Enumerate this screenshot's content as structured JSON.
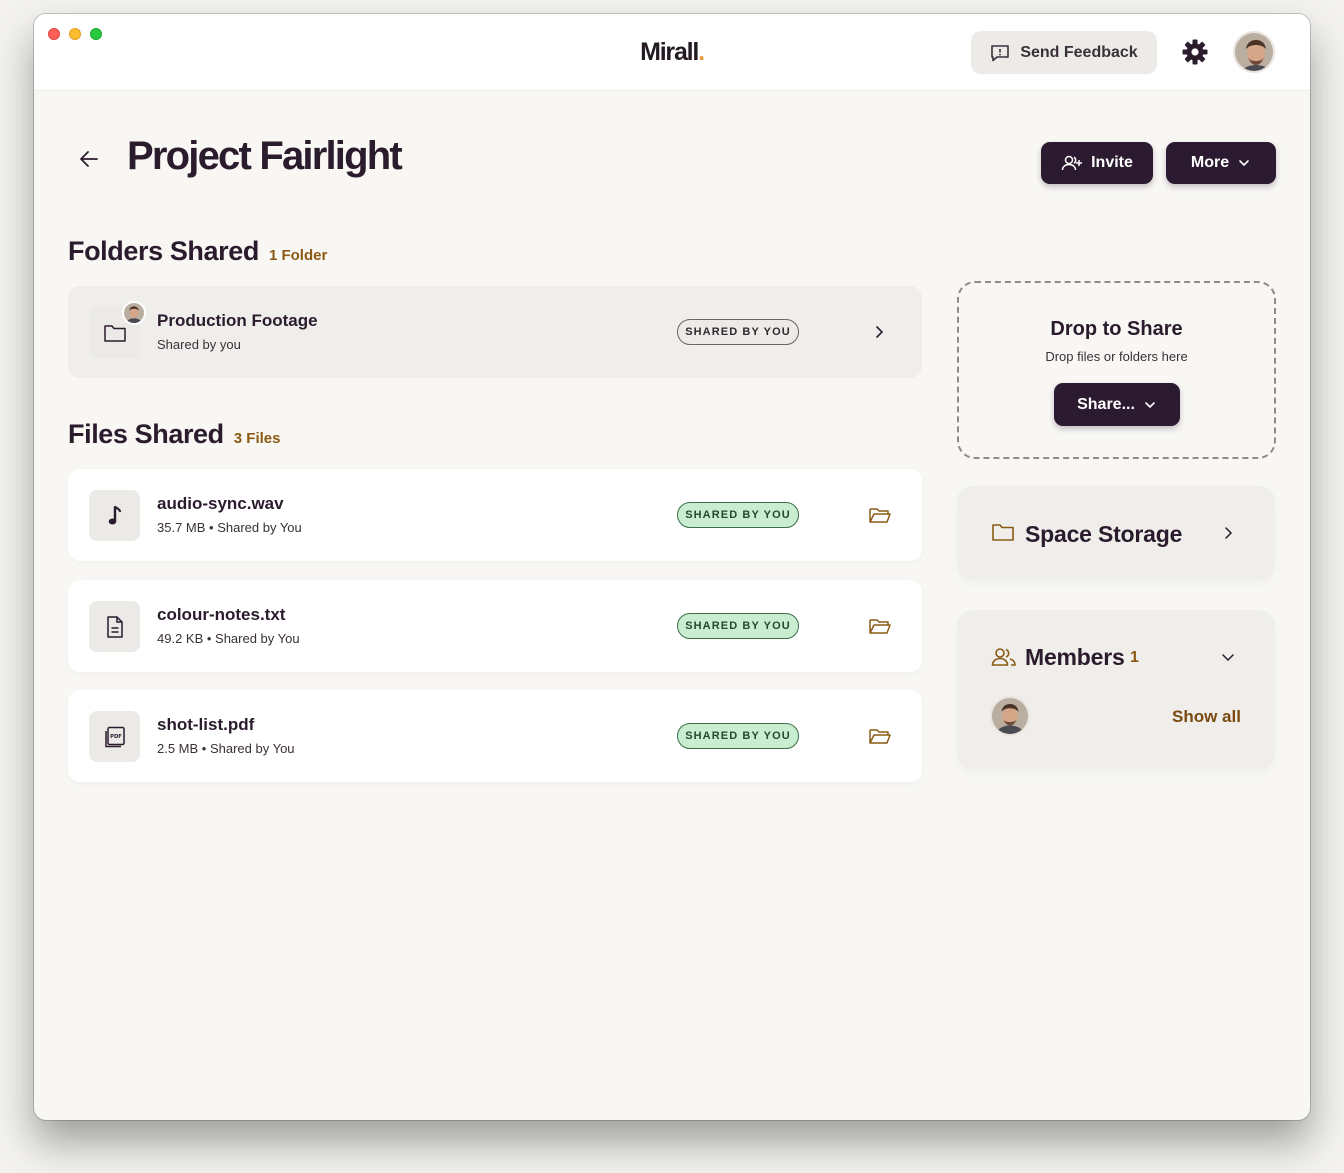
{
  "app": {
    "logo_text": "Mirall",
    "logo_dot": ".",
    "feedback_label": "Send Feedback",
    "settings_icon": "gear-icon",
    "avatar_icon": "user-avatar"
  },
  "header": {
    "title": "Project Fairlight",
    "invite_label": "Invite",
    "more_label": "More"
  },
  "folders": {
    "title": "Folders Shared",
    "count": "1 Folder",
    "items": [
      {
        "name": "Production Footage",
        "meta": "Shared by you",
        "badge": "SHARED BY YOU",
        "icon": "folder-icon"
      }
    ]
  },
  "files": {
    "title": "Files Shared",
    "count": "3 Files",
    "items": [
      {
        "name": "audio-sync.wav",
        "meta": "35.7 MB • Shared by You",
        "badge": "SHARED BY YOU",
        "icon": "music-note-icon"
      },
      {
        "name": "colour-notes.txt",
        "meta": "49.2 KB • Shared by You",
        "badge": "SHARED BY YOU",
        "icon": "text-file-icon"
      },
      {
        "name": "shot-list.pdf",
        "meta": "2.5 MB • Shared by You",
        "badge": "SHARED BY YOU",
        "icon": "pdf-file-icon"
      }
    ]
  },
  "drop": {
    "title": "Drop to Share",
    "subtitle": "Drop files or folders here",
    "share_label": "Share..."
  },
  "storage": {
    "title": "Space Storage"
  },
  "members": {
    "title": "Members",
    "count": "1",
    "show_all": "Show all"
  },
  "colors": {
    "accent_dark": "#2c1a30",
    "accent_brown": "#8a5a14",
    "badge_green": "#c9edd1",
    "logo_dot": "#e79a3c"
  }
}
